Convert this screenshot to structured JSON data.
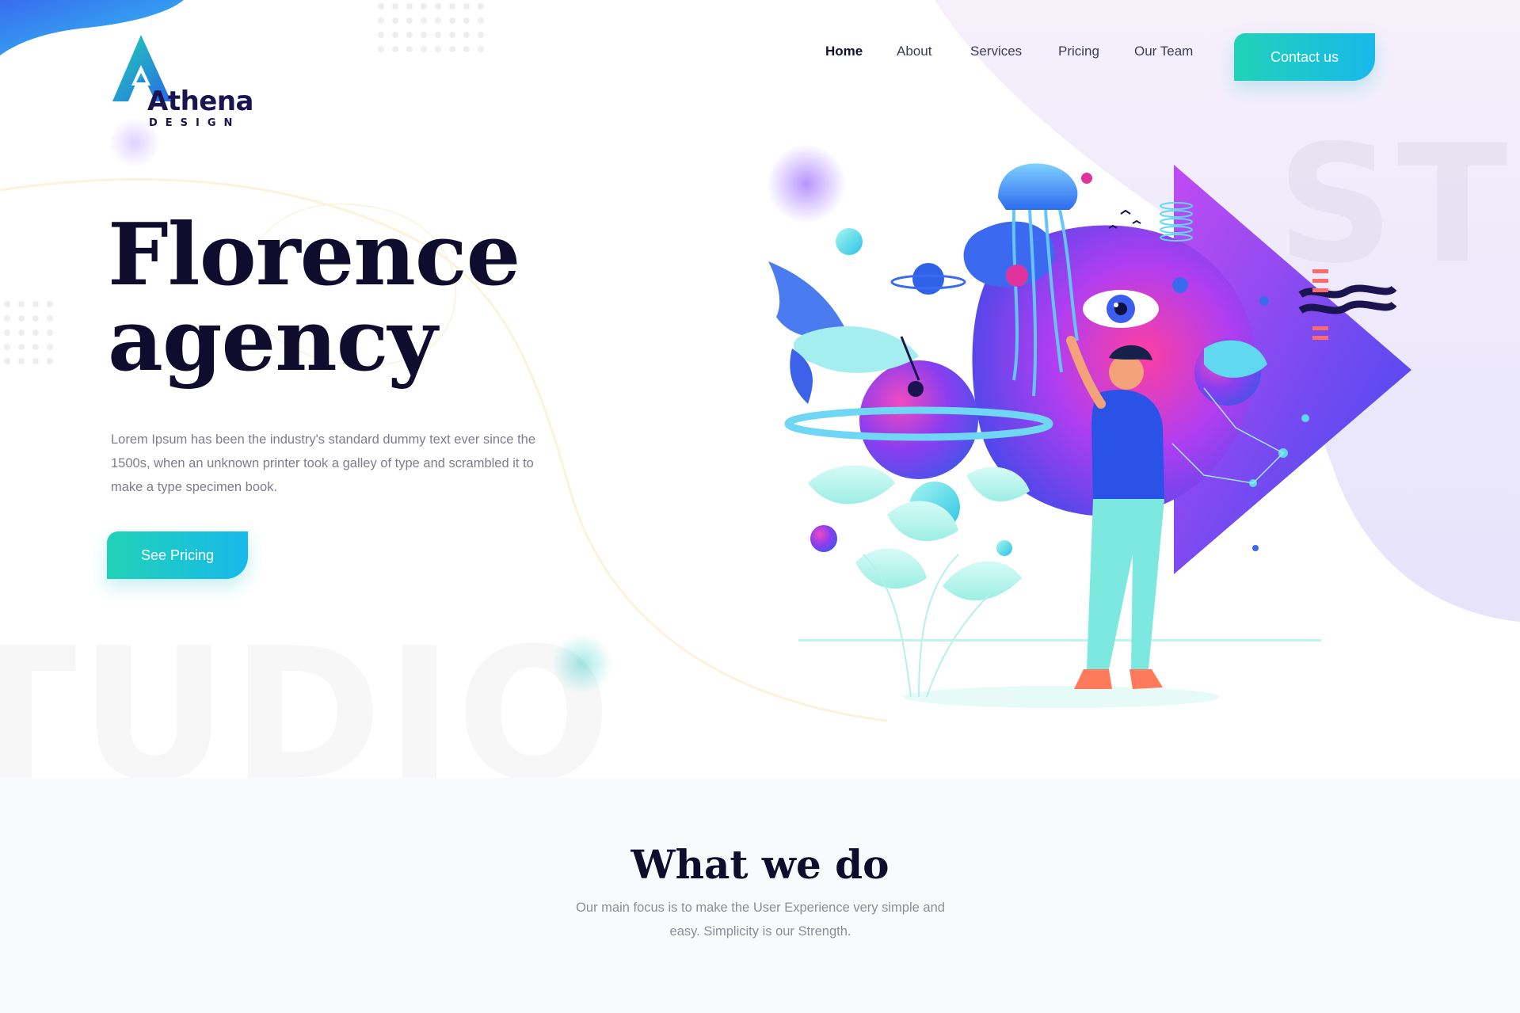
{
  "brand": {
    "name": "Athena",
    "tagline": "DESIGN"
  },
  "nav": {
    "items": [
      {
        "label": "Home",
        "active": true
      },
      {
        "label": "About"
      },
      {
        "label": "Services"
      },
      {
        "label": "Pricing"
      },
      {
        "label": "Our Team"
      }
    ],
    "cta_label": "Contact us"
  },
  "hero": {
    "title_line1": "Florence",
    "title_line2": "agency",
    "description": "Lorem Ipsum has been the industry's standard dummy text ever since the 1500s, when an unknown printer took a galley of type and scrambled it to make a type specimen book.",
    "button_label": "See Pricing",
    "watermark_bottom": "TUDIO",
    "watermark_top": "STU"
  },
  "what_we_do": {
    "title": "What we do",
    "description": "Our main focus is to make the User Experience very simple and easy. Simplicity is our Strength."
  },
  "colors": {
    "primary_dark": "#0f0c2e",
    "accent_teal": "#21d2b8",
    "accent_blue": "#17b9ea",
    "illustration_purple": "#7a3cf0",
    "illustration_pink": "#f0309a"
  },
  "icons": [
    "athena-logo-icon",
    "dot-grid-icon",
    "hero-illustration"
  ]
}
